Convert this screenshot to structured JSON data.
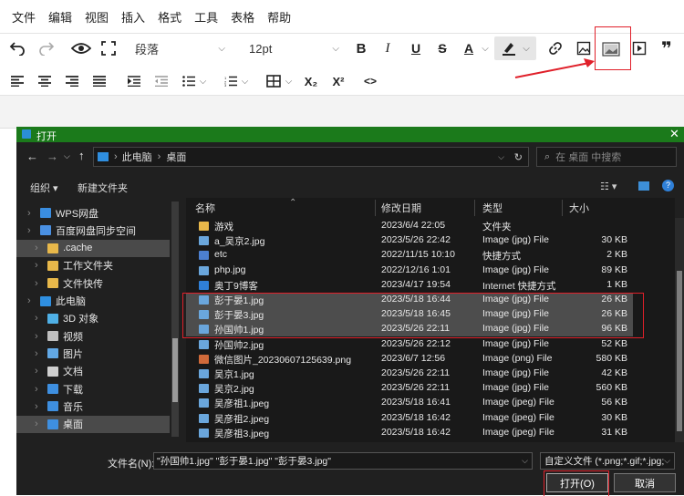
{
  "menubar": [
    "文件",
    "编辑",
    "视图",
    "插入",
    "格式",
    "工具",
    "表格",
    "帮助"
  ],
  "toolbar": {
    "paragraph_style": "段落",
    "font_size": "12pt",
    "bold": "B",
    "italic": "I",
    "underline": "U",
    "strikethrough": "S",
    "text_color": "A",
    "subscript": "X₂",
    "superscript": "X²",
    "code": "<>"
  },
  "dialog": {
    "title": "打开",
    "breadcrumb": [
      "此电脑",
      "桌面"
    ],
    "search_placeholder": "在 桌面 中搜索",
    "organize": "组织 ▾",
    "new_folder": "新建文件夹",
    "nav": [
      {
        "label": "WPS网盘",
        "icon": "cloud-icon"
      },
      {
        "label": "百度网盘同步空间",
        "icon": "baidu-icon"
      },
      {
        "label": ".cache",
        "icon": "folder-icon",
        "selected": true
      },
      {
        "label": "工作文件夹",
        "icon": "folder-icon"
      },
      {
        "label": "文件快传",
        "icon": "folder-icon"
      },
      {
        "label": "此电脑",
        "icon": "computer-icon"
      },
      {
        "label": "3D 对象",
        "icon": "3d-icon"
      },
      {
        "label": "视频",
        "icon": "video-icon"
      },
      {
        "label": "图片",
        "icon": "picture-icon"
      },
      {
        "label": "文档",
        "icon": "document-icon"
      },
      {
        "label": "下载",
        "icon": "download-icon"
      },
      {
        "label": "音乐",
        "icon": "music-icon"
      },
      {
        "label": "桌面",
        "icon": "desktop-icon",
        "selected": true
      }
    ],
    "columns": [
      "名称",
      "修改日期",
      "类型",
      "大小"
    ],
    "files": [
      {
        "name": "游戏",
        "date": "2023/6/4 22:05",
        "type": "文件夹",
        "size": "",
        "icon": "folder-icon"
      },
      {
        "name": "a_吴京2.jpg",
        "date": "2023/5/26 22:42",
        "type": "Image (jpg) File",
        "size": "30 KB",
        "icon": "image-icon"
      },
      {
        "name": "etc",
        "date": "2022/11/15 10:10",
        "type": "快捷方式",
        "size": "2 KB",
        "icon": "shortcut-icon"
      },
      {
        "name": "php.jpg",
        "date": "2022/12/16 1:01",
        "type": "Image (jpg) File",
        "size": "89 KB",
        "icon": "image-icon"
      },
      {
        "name": "奥丁9博客",
        "date": "2023/4/17 19:54",
        "type": "Internet 快捷方式",
        "size": "1 KB",
        "icon": "internet-shortcut-icon"
      },
      {
        "name": "彭于晏1.jpg",
        "date": "2023/5/18 16:44",
        "type": "Image (jpg) File",
        "size": "26 KB",
        "icon": "image-icon",
        "selected": true
      },
      {
        "name": "彭于晏3.jpg",
        "date": "2023/5/18 16:45",
        "type": "Image (jpg) File",
        "size": "26 KB",
        "icon": "image-icon",
        "selected": true
      },
      {
        "name": "孙国帅1.jpg",
        "date": "2023/5/26 22:11",
        "type": "Image (jpg) File",
        "size": "96 KB",
        "icon": "image-icon",
        "selected": true
      },
      {
        "name": "孙国帅2.jpg",
        "date": "2023/5/26 22:12",
        "type": "Image (jpg) File",
        "size": "52 KB",
        "icon": "image-icon"
      },
      {
        "name": "微信图片_20230607125639.png",
        "date": "2023/6/7 12:56",
        "type": "Image (png) File",
        "size": "580 KB",
        "icon": "png-image-icon"
      },
      {
        "name": "吴京1.jpg",
        "date": "2023/5/26 22:11",
        "type": "Image (jpg) File",
        "size": "42 KB",
        "icon": "image-icon"
      },
      {
        "name": "吴京2.jpg",
        "date": "2023/5/26 22:11",
        "type": "Image (jpg) File",
        "size": "560 KB",
        "icon": "image-icon"
      },
      {
        "name": "吴彦祖1.jpeg",
        "date": "2023/5/18 16:41",
        "type": "Image (jpeg) File",
        "size": "56 KB",
        "icon": "image-icon"
      },
      {
        "name": "吴彦祖2.jpeg",
        "date": "2023/5/18 16:42",
        "type": "Image (jpeg) File",
        "size": "30 KB",
        "icon": "image-icon"
      },
      {
        "name": "吴彦祖3.jpeg",
        "date": "2023/5/18 16:42",
        "type": "Image (jpeg) File",
        "size": "31 KB",
        "icon": "image-icon"
      }
    ],
    "filename_label": "文件名(N):",
    "filename_value": "\"孙国帅1.jpg\" \"彭于晏1.jpg\" \"彭于晏3.jpg\"",
    "filetype_value": "自定义文件 (*.png;*.gif;*.jpg;*",
    "open_button": "打开(O)",
    "cancel_button": "取消"
  },
  "colors": {
    "highlight": "#e0202a",
    "title_bar": "#1b7a1b",
    "dialog_bg": "#202020"
  }
}
